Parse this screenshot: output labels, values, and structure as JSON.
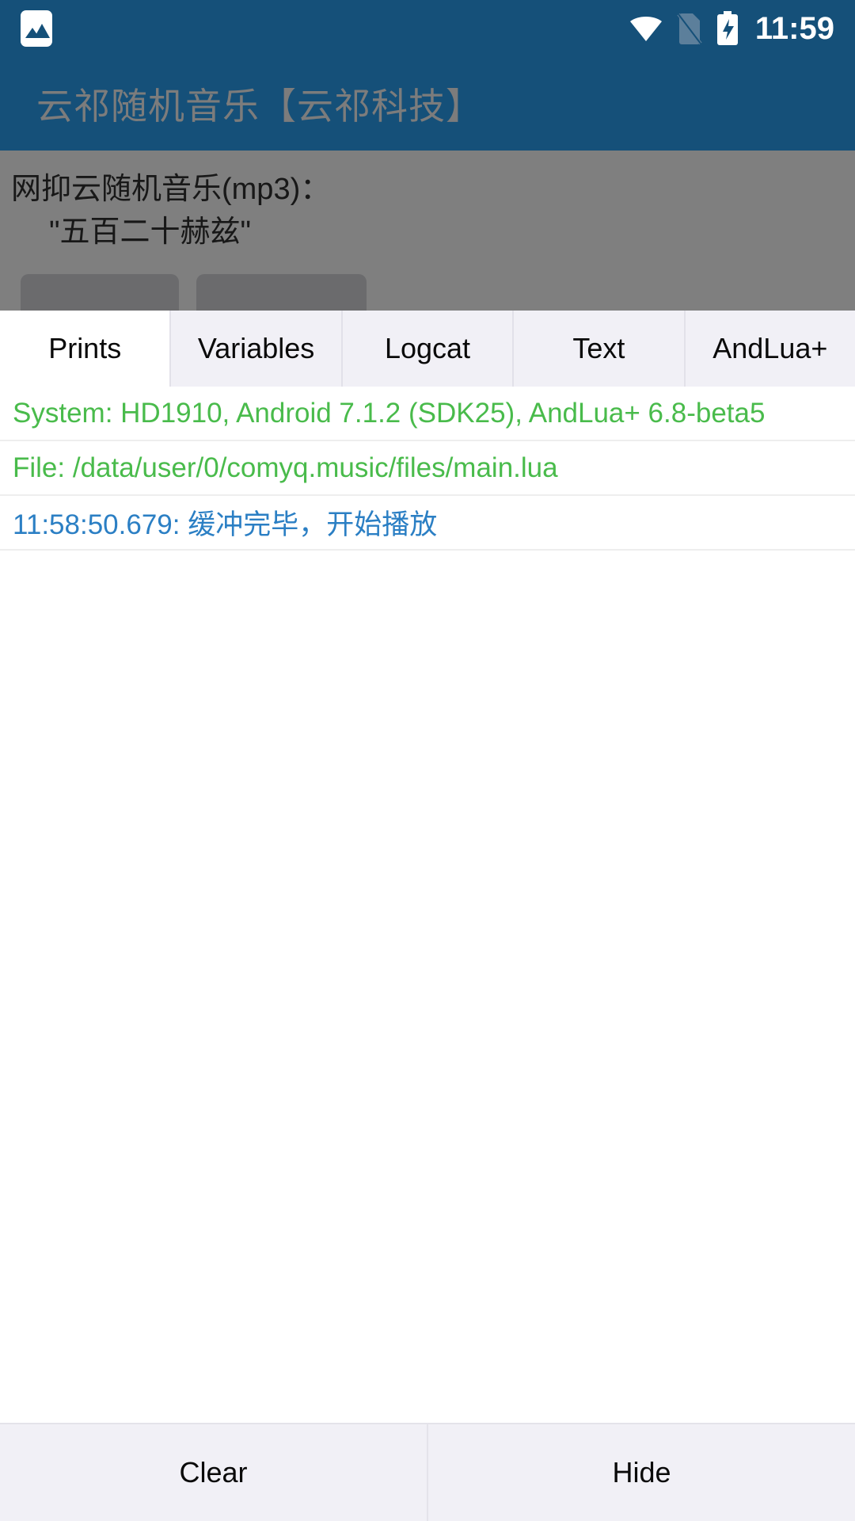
{
  "status_bar": {
    "notification_icon": "image-icon",
    "wifi_icon": "wifi-icon",
    "sim_icon": "no-sim-card-icon",
    "battery_icon": "battery-charging-icon",
    "time": "11:59"
  },
  "action_bar": {
    "title": "云祁随机音乐【云祁科技】",
    "background_color": "#155079",
    "title_color": "#7c7c7c"
  },
  "background_app": {
    "line1": "网抑云随机音乐(mp3)：",
    "line2": "\"五百二十赫兹\"",
    "buttons": [
      {
        "label": ""
      },
      {
        "label": ""
      }
    ]
  },
  "console": {
    "tabs": [
      {
        "label": "Prints",
        "active": true
      },
      {
        "label": "Variables",
        "active": false
      },
      {
        "label": "Logcat",
        "active": false
      },
      {
        "label": "Text",
        "active": false
      },
      {
        "label": "AndLua+",
        "active": false
      }
    ],
    "logs": [
      {
        "text": "System: HD1910, Android 7.1.2 (SDK25), AndLua+ 6.8-beta5",
        "color": "green"
      },
      {
        "text": "File: /data/user/0/comyq.music/files/main.lua",
        "color": "green"
      },
      {
        "text": "11:58:50.679: 缓冲完毕，开始播放",
        "color": "blue"
      }
    ],
    "log_colors": {
      "green": "#49bb4b",
      "blue": "#2b7fc4"
    },
    "bottom_buttons": [
      {
        "label": "Clear"
      },
      {
        "label": "Hide"
      }
    ]
  }
}
